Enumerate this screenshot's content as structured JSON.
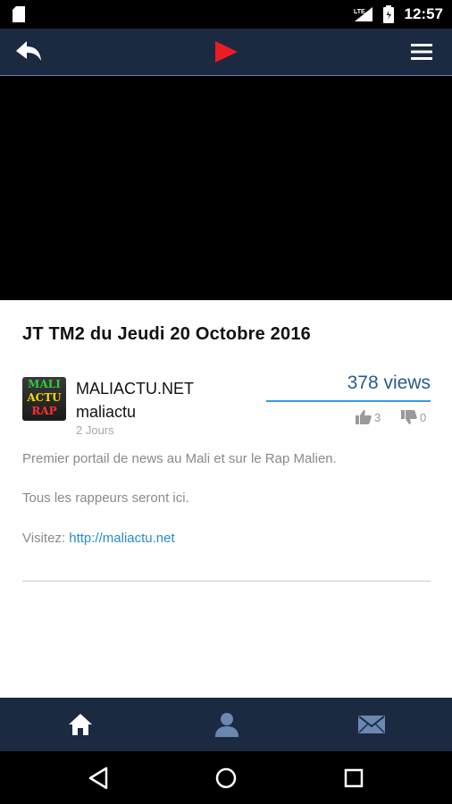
{
  "status_bar": {
    "time": "12:57",
    "network": "LTE"
  },
  "header": {
    "back_icon": "back-arrow-icon",
    "logo_icon": "play-logo-icon",
    "menu_icon": "hamburger-menu-icon",
    "logo_color": "#ed1c24"
  },
  "video": {
    "title": "JT TM2 du Jeudi 20 Octobre 2016"
  },
  "channel": {
    "avatar_text": [
      "MALI",
      "ACTU",
      "RAP"
    ],
    "name": "MALIACTU.NET",
    "username": "maliactu",
    "posted": "2 Jours"
  },
  "stats": {
    "views": "378 views",
    "likes": "3",
    "dislikes": "0"
  },
  "description": {
    "line1": "Premier portail de news au Mali et sur le Rap Malien.",
    "line2": "Tous les rappeurs seront ici.",
    "visit_label": "Visitez: ",
    "visit_link": "http://maliactu.net"
  },
  "bottom_nav": {
    "items": [
      "home-icon",
      "profile-icon",
      "mail-icon"
    ]
  },
  "colors": {
    "header_bg": "#1b2941",
    "accent": "#3a9ad9",
    "views_text": "#2a5b8e"
  }
}
